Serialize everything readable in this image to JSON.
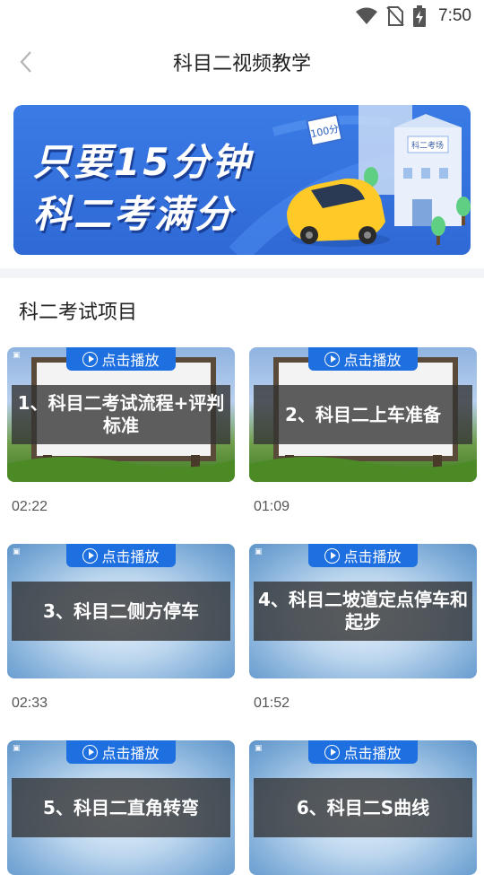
{
  "status_bar": {
    "time": "7:50"
  },
  "header": {
    "title": "科目二视频教学"
  },
  "banner": {
    "line1": "只要15分钟",
    "line2": "科二考满分",
    "badge": "100分",
    "building_sign": "科二考场"
  },
  "section": {
    "title": "科二考试项目"
  },
  "videos": [
    {
      "play_label": "点击播放",
      "title": "1、科目二考试流程+评判标准",
      "duration": "02:22"
    },
    {
      "play_label": "点击播放",
      "title": "2、科目二上车准备",
      "duration": "01:09"
    },
    {
      "play_label": "点击播放",
      "title": "3、科目二侧方停车",
      "duration": "02:33"
    },
    {
      "play_label": "点击播放",
      "title": "4、科目二坡道定点停车和起步",
      "duration": "01:52"
    },
    {
      "play_label": "点击播放",
      "title": "5、科目二直角转弯",
      "duration": ""
    },
    {
      "play_label": "点击播放",
      "title": "6、科目二S曲线",
      "duration": ""
    }
  ],
  "colors": {
    "accent": "#1e6fe0",
    "banner_bg": "#2f69d6",
    "divider": "#f2f4f7"
  }
}
